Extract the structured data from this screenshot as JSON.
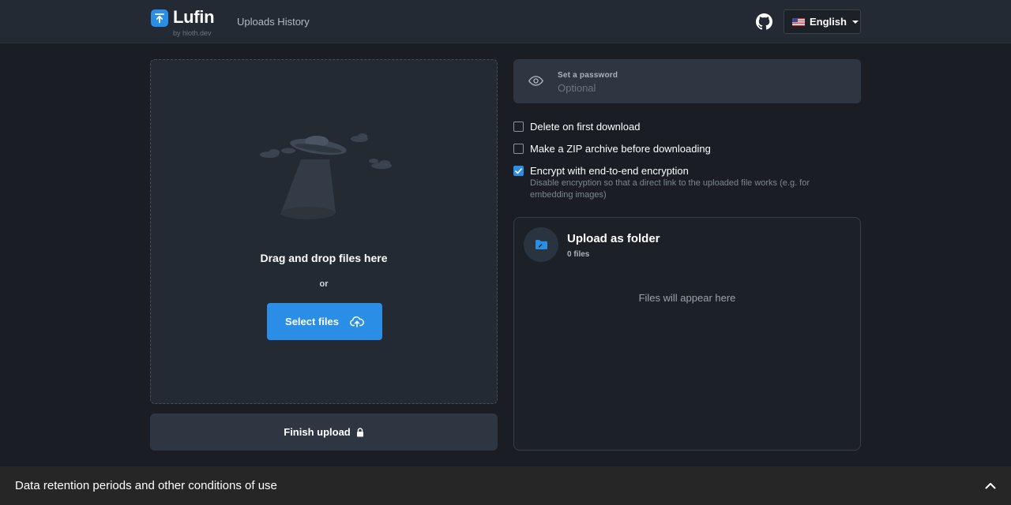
{
  "header": {
    "app_name": "Lufin",
    "app_byline": "by hloth.dev",
    "nav_uploads_history": "Uploads History",
    "language": "English"
  },
  "dropzone": {
    "drag_text": "Drag and drop files here",
    "or_text": "or",
    "select_label": "Select files"
  },
  "finish_label": "Finish upload",
  "password": {
    "label": "Set a password",
    "placeholder": "Optional",
    "value": ""
  },
  "options": [
    {
      "label": "Delete on first download",
      "checked": false
    },
    {
      "label": "Make a ZIP archive before downloading",
      "checked": false
    },
    {
      "label": "Encrypt with end-to-end encryption",
      "checked": true
    }
  ],
  "encrypt_hint": "Disable encryption so that a direct link to the uploaded file works (e.g. for embedding images)",
  "folder": {
    "title": "Upload as folder",
    "count": "0 files",
    "empty": "Files will appear here"
  },
  "footer": {
    "text": "Data retention periods and other conditions of use"
  },
  "colors": {
    "accent": "#2b8ee6",
    "background": "#1a1e24",
    "panel": "#232a33"
  }
}
